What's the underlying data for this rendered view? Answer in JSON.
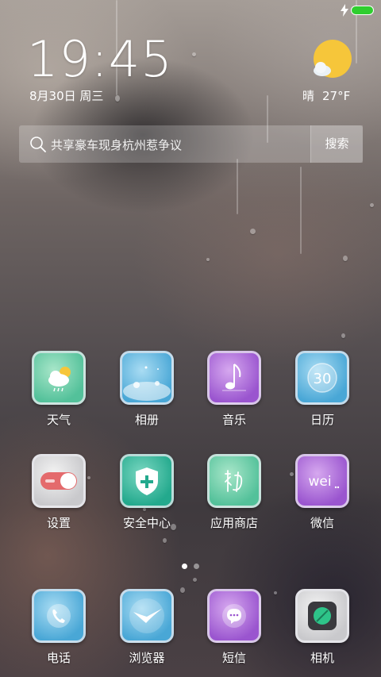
{
  "status_bar": {
    "charging_icon": "bolt-icon",
    "battery_color": "#2fce2f"
  },
  "clock": {
    "time": "19:45",
    "date": "8月30日 周三"
  },
  "weather": {
    "icon": "sun-cloud-icon",
    "condition": "晴",
    "temperature": "27°F"
  },
  "search": {
    "placeholder": "共享豪车现身杭州惹争议",
    "button_label": "搜索"
  },
  "apps": [
    {
      "label": "天气",
      "icon": "weather-app-icon",
      "color": "#53c19a"
    },
    {
      "label": "相册",
      "icon": "gallery-app-icon",
      "color": "#49a7d6"
    },
    {
      "label": "音乐",
      "icon": "music-app-icon",
      "color": "#9a55cf"
    },
    {
      "label": "日历",
      "icon": "calendar-app-icon",
      "color": "#49a7d6",
      "icon_text": "30"
    },
    {
      "label": "设置",
      "icon": "settings-app-icon",
      "color": "#c9c9cc"
    },
    {
      "label": "安全中心",
      "icon": "security-app-icon",
      "color": "#23a98d"
    },
    {
      "label": "应用商店",
      "icon": "app-store-icon",
      "color": "#53c19a"
    },
    {
      "label": "微信",
      "icon": "wechat-app-icon",
      "color": "#9a55cf",
      "icon_text": "wei"
    }
  ],
  "page_indicator": {
    "pages": 2,
    "current": 1
  },
  "dock": [
    {
      "label": "电话",
      "icon": "phone-app-icon",
      "color": "#49a7d6"
    },
    {
      "label": "浏览器",
      "icon": "browser-app-icon",
      "color": "#49a7d6"
    },
    {
      "label": "短信",
      "icon": "messages-app-icon",
      "color": "#9a55cf"
    },
    {
      "label": "相机",
      "icon": "camera-app-icon",
      "color": "#c9c9cc"
    }
  ]
}
